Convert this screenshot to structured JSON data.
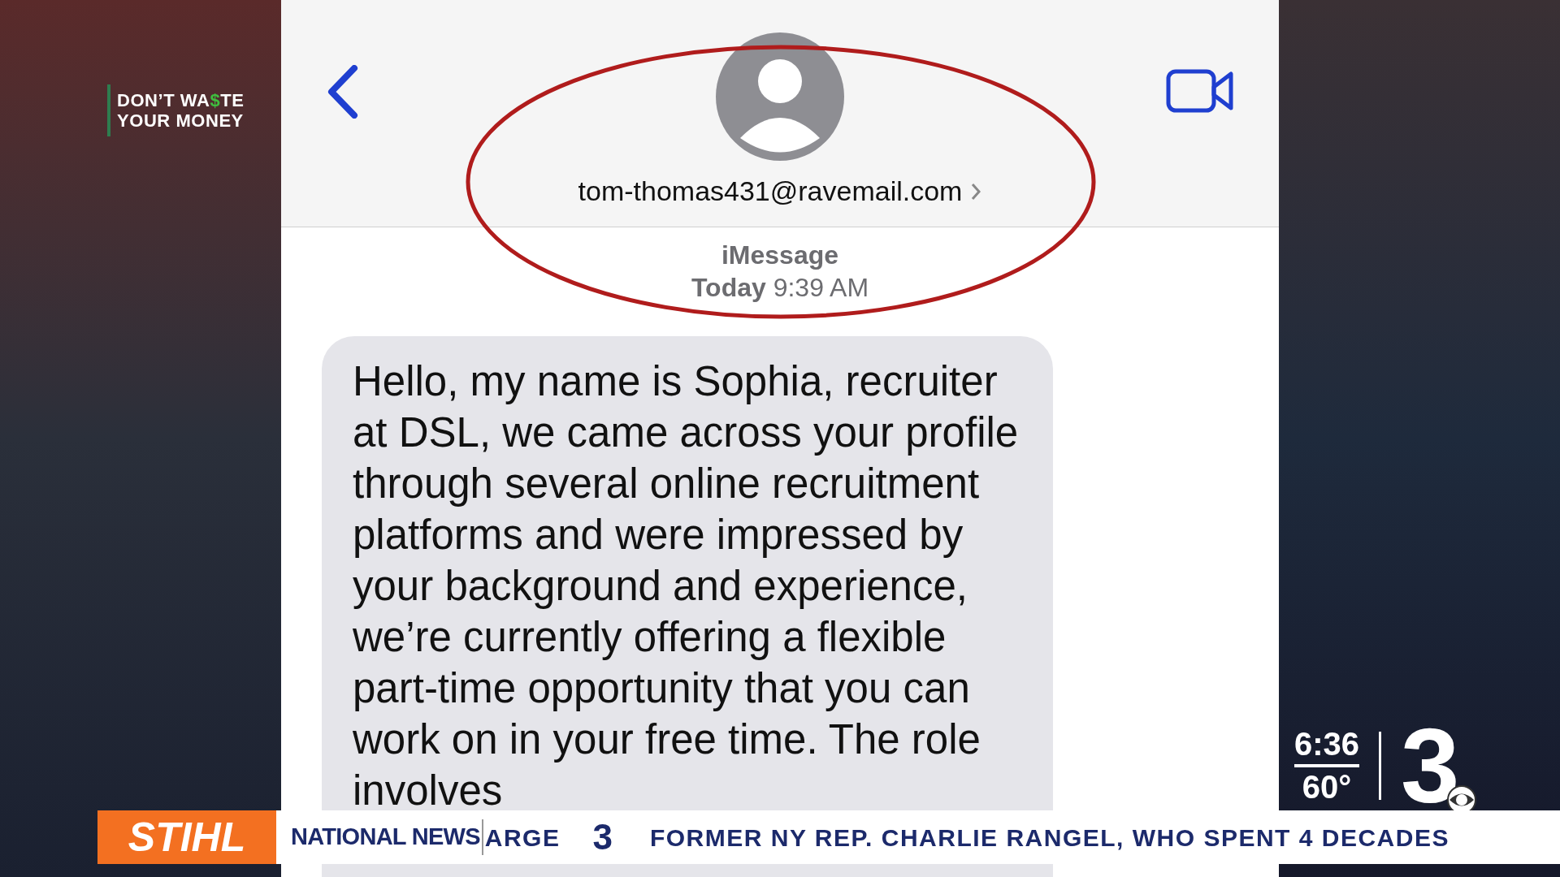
{
  "show_logo": {
    "line_1_a": "DON’T WA",
    "dollar": "$",
    "line_1_b": "TE",
    "line_2": "YOUR MONEY"
  },
  "conversation": {
    "contact": "tom-thomas431@ravemail.com",
    "service": "iMessage",
    "day": "Today",
    "time": "9:39 AM",
    "highlighted": true
  },
  "messages": [
    {
      "kind": "received",
      "text": "Hello, my name is Sophia, recruiter at DSL, we came across your profile through several online recruitment platforms and were impressed by your background and experience, we’re currently offering a flexible part-time opportunity that you can work on in your free time. The role involves"
    }
  ],
  "station": {
    "time": "6:36",
    "temperature": "60°",
    "channel": "3"
  },
  "ticker": {
    "sponsor": "STIHL",
    "section": "NATIONAL NEWS",
    "previous_fragment": "ARGE",
    "channel": "3",
    "headline": "FORMER NY REP. CHARLIE RANGEL, WHO SPENT 4 DECADES"
  }
}
